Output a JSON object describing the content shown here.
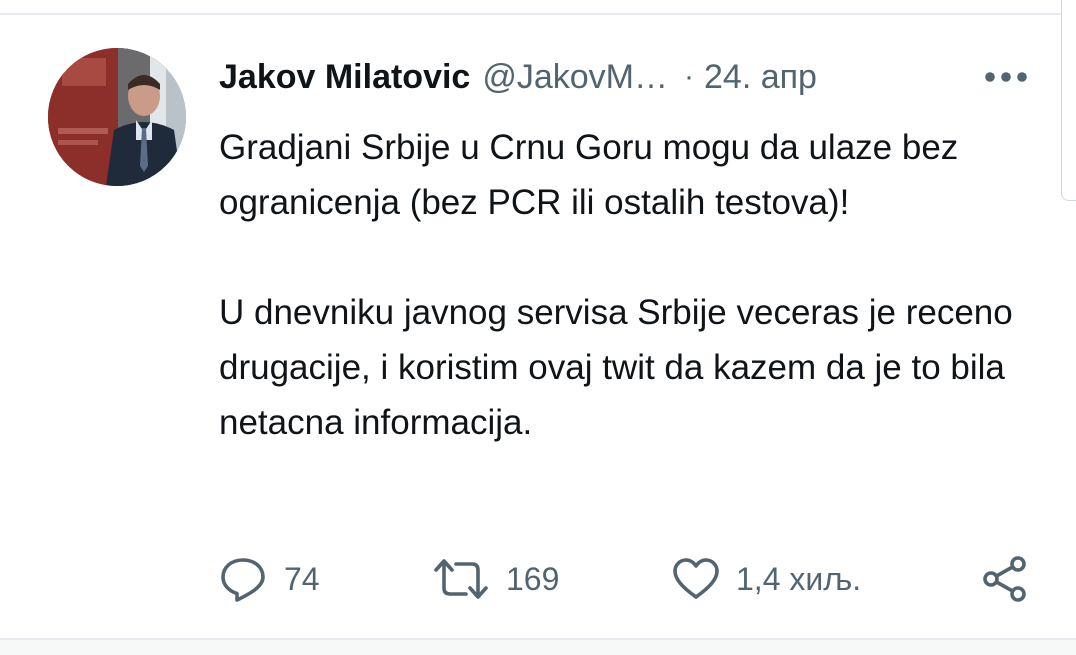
{
  "tweet": {
    "author_name": "Jakov Milatovic",
    "handle": "@JakovM…",
    "separator": "·",
    "timestamp": "24. апр",
    "text_paragraph_1": "Gradjani Srbije u Crnu Goru mogu da ulaze bez ogranicenja (bez PCR ili ostalih testova)!",
    "text_paragraph_2": "U dnevniku javnog servisa Srbije veceras je receno drugacije, i koristim ovaj twit da kazem da je to bila netacna informacija."
  },
  "actions": {
    "reply_icon": "reply-icon",
    "reply_count": "74",
    "retweet_icon": "retweet-icon",
    "retweet_count": "169",
    "like_icon": "heart-icon",
    "like_count": "1,4 хиљ.",
    "share_icon": "share-icon"
  },
  "colors": {
    "text_primary": "#0f1419",
    "text_secondary": "#536471",
    "divider": "#e6ecf0"
  }
}
